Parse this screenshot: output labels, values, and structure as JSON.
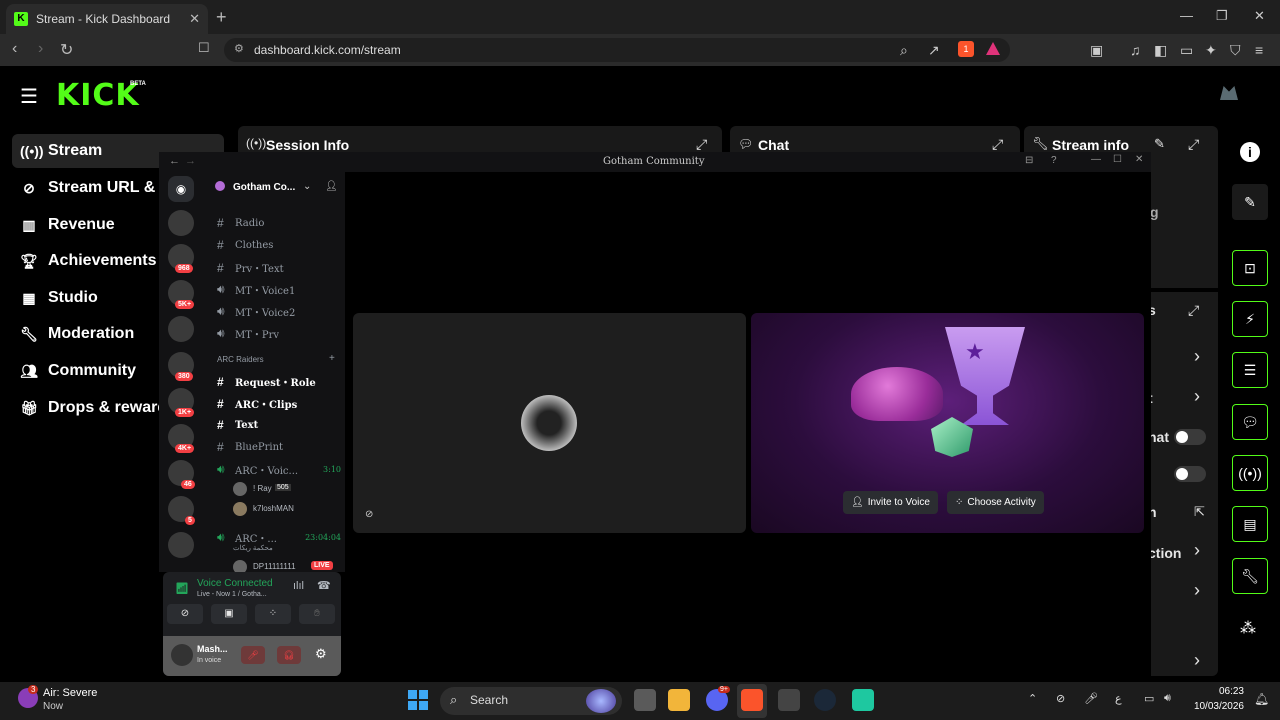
{
  "browser": {
    "tab_title": "Stream - Kick Dashboard",
    "url": "dashboard.kick.com/stream",
    "brave_badge": "1"
  },
  "kick": {
    "logo": "KICK",
    "beta": "BETA",
    "sidebar": [
      {
        "label": "Stream",
        "icon": "stream-icon",
        "active": true
      },
      {
        "label": "Stream URL & K",
        "icon": "link-icon"
      },
      {
        "label": "Revenue",
        "icon": "chart-icon"
      },
      {
        "label": "Achievements",
        "icon": "trophy-icon"
      },
      {
        "label": "Studio",
        "icon": "film-icon"
      },
      {
        "label": "Moderation",
        "icon": "wrench-icon"
      },
      {
        "label": "Community",
        "icon": "users-icon"
      },
      {
        "label": "Drops & reward",
        "icon": "gift-icon"
      }
    ],
    "panels": {
      "session": "Session Info",
      "chat": "Chat",
      "stream_info": "Stream info"
    },
    "partial_texts": [
      "g",
      "s",
      "t",
      "hat",
      "n",
      "ction"
    ]
  },
  "discord": {
    "window_title": "Gotham Community",
    "server_name": "Gotham Co...",
    "channels": [
      {
        "name": "Radio",
        "type": "text"
      },
      {
        "name": "Clothes",
        "type": "text"
      },
      {
        "name": "Prv・Text",
        "type": "text"
      },
      {
        "name": "MT・Voice1",
        "type": "voice"
      },
      {
        "name": "MT・Voice2",
        "type": "voice"
      },
      {
        "name": "MT・Prv",
        "type": "voice"
      }
    ],
    "category": "ARC Raiders",
    "arc_channels": [
      {
        "name": "Request・Role",
        "type": "text",
        "bold": true
      },
      {
        "name": "ARC・Clips",
        "type": "text",
        "bold": true
      },
      {
        "name": "Text",
        "type": "text",
        "bold": true
      },
      {
        "name": "BluePrint",
        "type": "text",
        "bold": false
      }
    ],
    "voice_channel1": {
      "name": "ARC・Voic...",
      "time": "3:10"
    },
    "voice_users1": [
      {
        "name": "! Ray",
        "badge": "505"
      },
      {
        "name": "k7loshMAN"
      }
    ],
    "voice_channel2": {
      "name": "ARC・...",
      "time": "23:04:04",
      "sub": "محكمة ريكات"
    },
    "voice_user2": {
      "name": "DP11111111",
      "live": "LIVE"
    },
    "server_badges": [
      "968",
      "5K+",
      "380",
      "1K+",
      "4K+",
      "46",
      "5"
    ],
    "voice_connected": "Voice Connected",
    "voice_sub": "Live - Now 1 / Gotha...",
    "user_name": "Mash...",
    "user_status": "In voice",
    "invite": "Invite to Voice",
    "activity": "Choose Activity"
  },
  "taskbar": {
    "weather_title": "Air: Severe",
    "weather_sub": "Now",
    "weather_badge": "3",
    "search": "Search",
    "time": "06:23",
    "date": "10/03/2026",
    "lang": "ع",
    "discord_badge": "9+"
  },
  "colors": {
    "kick_green": "#53fc18",
    "discord_bg": "#121214",
    "live_red": "#f23f43"
  }
}
